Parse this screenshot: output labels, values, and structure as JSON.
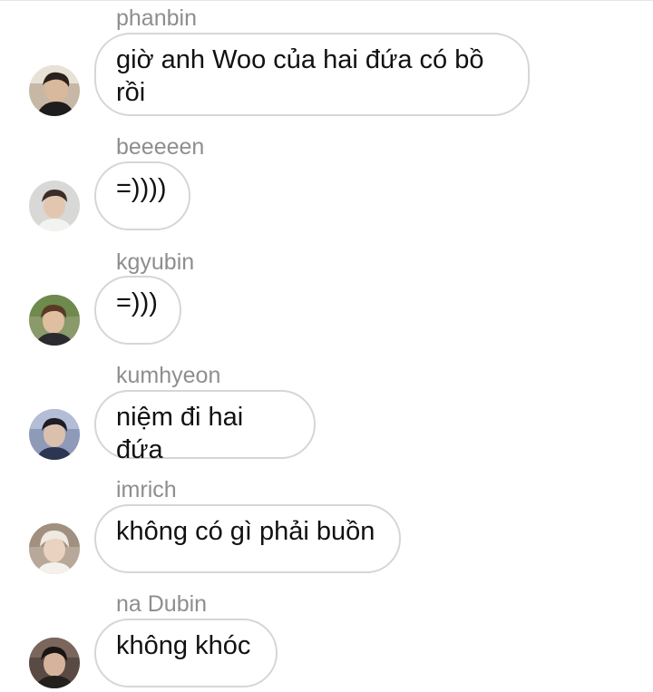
{
  "messages": [
    {
      "username": "phanbin",
      "text": "giờ anh Woo của hai đứa có bồ\nrồi",
      "avatar": "avatar-icon"
    },
    {
      "username": "beeeeen",
      "text": "=))))",
      "avatar": "avatar-icon"
    },
    {
      "username": "kgyubin",
      "text": "=)))",
      "avatar": "avatar-icon"
    },
    {
      "username": "kumhyeon",
      "text": "niệm đi hai đứa",
      "avatar": "avatar-icon"
    },
    {
      "username": "imrich",
      "text": "không có gì phải buồn",
      "avatar": "avatar-icon"
    },
    {
      "username": "na Dubin",
      "text": "không khóc",
      "avatar": "avatar-icon"
    }
  ],
  "colors": {
    "username": "#8e8e8e",
    "bubble_border": "#d6d6d6",
    "text": "#111111"
  }
}
